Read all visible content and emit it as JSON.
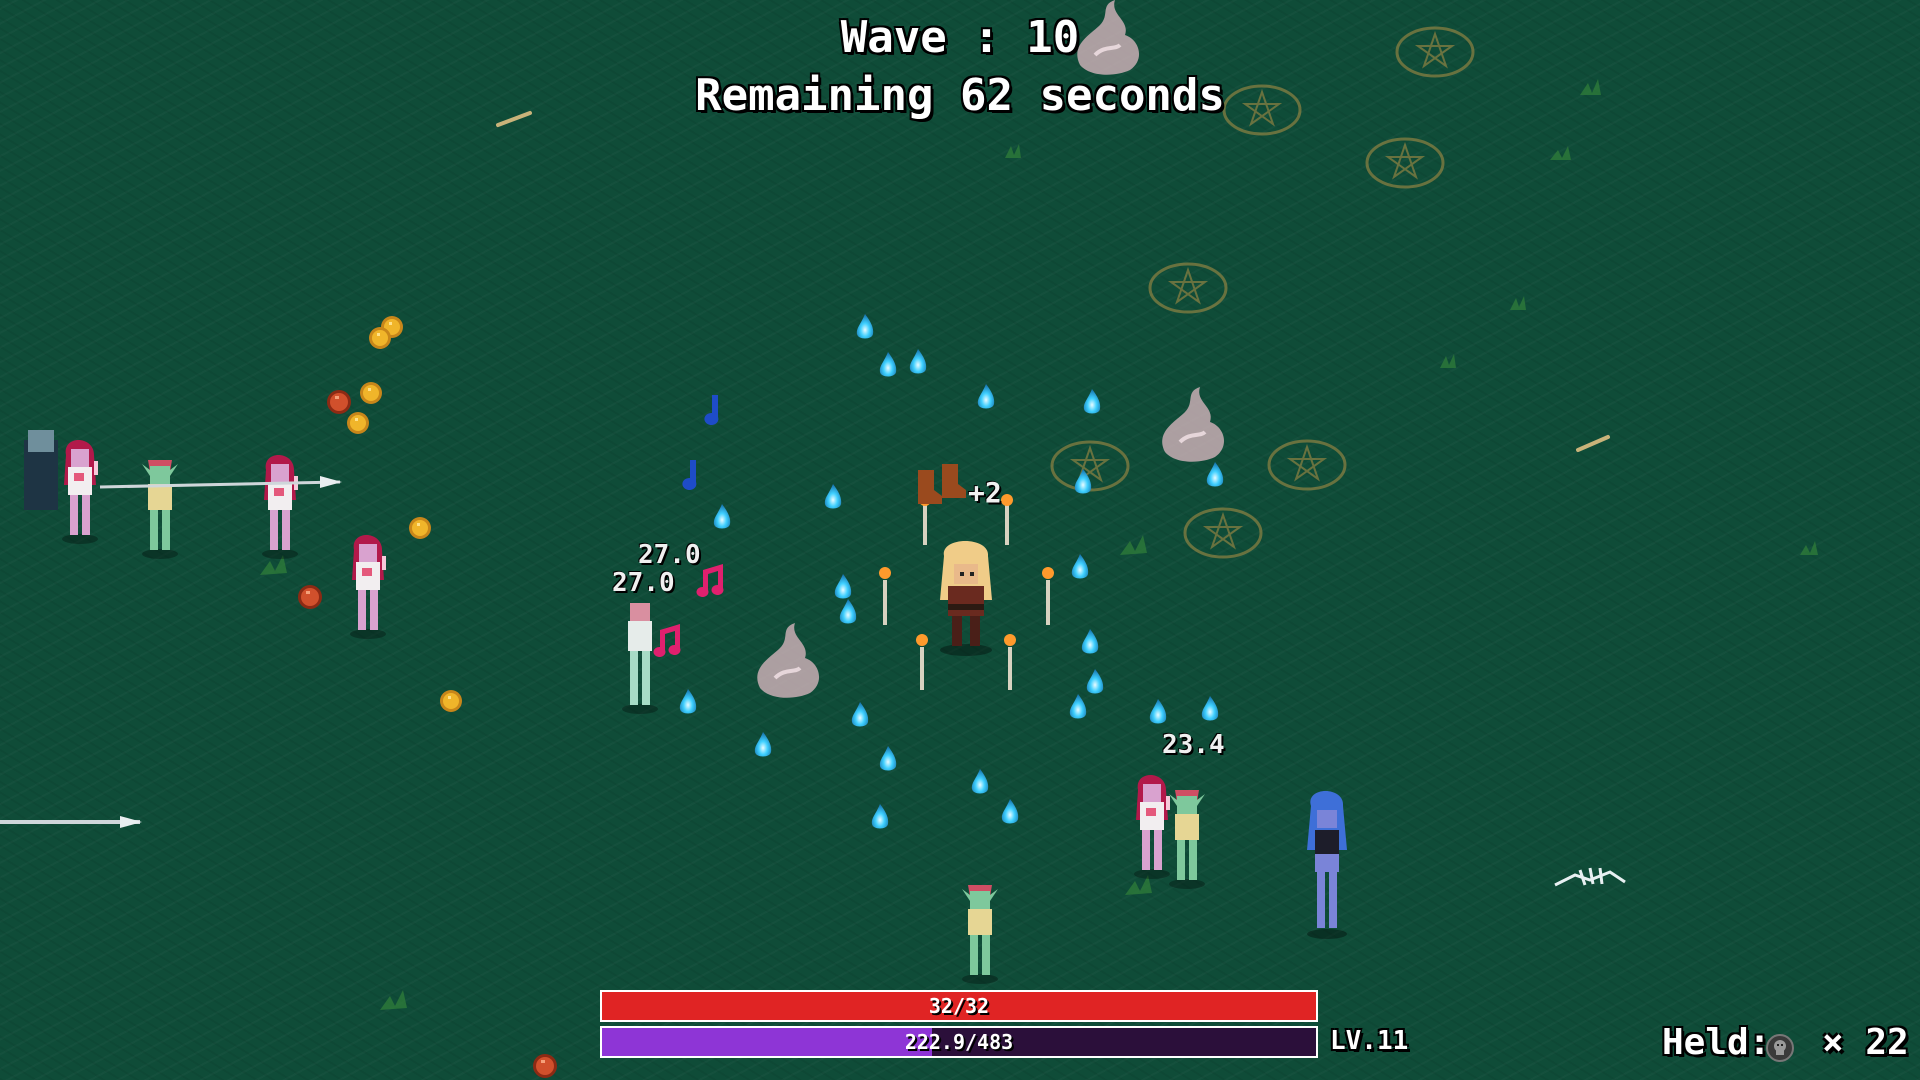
{
  "hud": {
    "wave_text": "Wave : 10",
    "remaining_text": "Remaining 62 seconds",
    "hp": {
      "text": "32/32",
      "current": 32,
      "max": 32,
      "color": "#e02424"
    },
    "xp": {
      "text": "222.9/483",
      "current": 222.9,
      "max": 483,
      "color": "#8e35d6"
    },
    "level_text": "LV.11",
    "held_label": "Held:",
    "held_icon": "skull-coin-icon",
    "held_count": "× 22"
  },
  "damage_numbers": [
    "27.0",
    "27.0",
    "23.4",
    "+2"
  ],
  "colors": {
    "grass": "#0f4c38",
    "flame": "#3fd0ff",
    "coin": "#e0a21a",
    "note": "#e0206e"
  }
}
